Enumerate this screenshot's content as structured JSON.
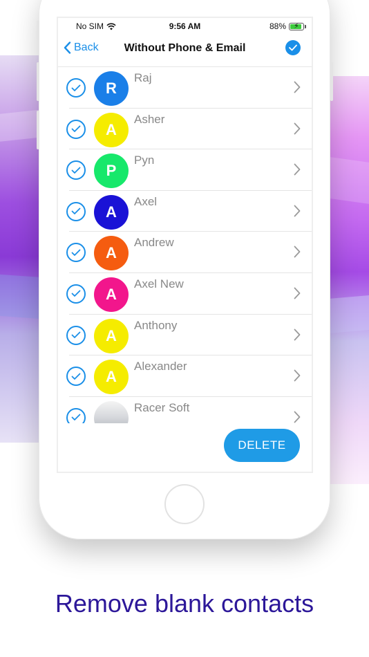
{
  "status_bar": {
    "carrier": "No SIM",
    "time": "9:56 AM",
    "battery": "88%"
  },
  "nav": {
    "back_label": "Back",
    "title": "Without Phone & Email"
  },
  "contacts": [
    {
      "name": "Raj",
      "initial": "R",
      "color": "#1a7fe8"
    },
    {
      "name": "Asher",
      "initial": "A",
      "color": "#f5ec00"
    },
    {
      "name": "Pyn",
      "initial": "P",
      "color": "#17e86b"
    },
    {
      "name": "Axel",
      "initial": "A",
      "color": "#1a12d6"
    },
    {
      "name": "Andrew",
      "initial": "A",
      "color": "#f55c10"
    },
    {
      "name": "Axel New",
      "initial": "A",
      "color": "#f2168c"
    },
    {
      "name": "Anthony",
      "initial": "A",
      "color": "#f5ec00"
    },
    {
      "name": "Alexander",
      "initial": "A",
      "color": "#f5ec00"
    },
    {
      "name": "Racer Soft",
      "initial": "",
      "color": "photo"
    }
  ],
  "delete_label": "DELETE",
  "caption": "Remove blank contacts",
  "colors": {
    "accent": "#1a8fe8",
    "caption": "#2c1799"
  }
}
